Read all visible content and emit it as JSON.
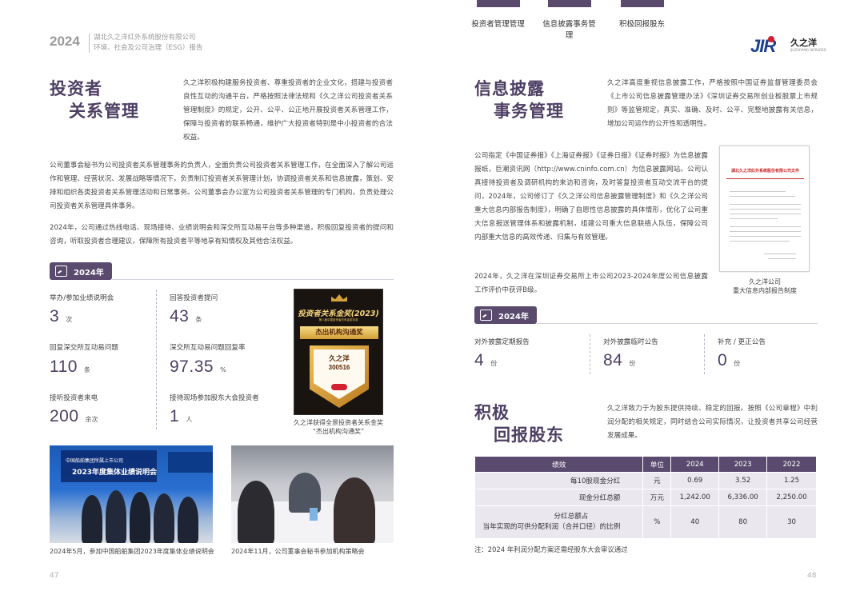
{
  "header": {
    "year": "2024",
    "company": "湖北久之洋红外系统股份有限公司",
    "report": "环境、社会及公司治理（ESG）报告"
  },
  "tabs": [
    {
      "label": "投资者管理管理"
    },
    {
      "label": "信息披露事务管理"
    },
    {
      "label": "积极回报股东"
    }
  ],
  "logo": {
    "mark": "JIR",
    "name": "久之洋",
    "tagline": "JIUZHIYANG INFRARED"
  },
  "left": {
    "title_line1": "投资者",
    "title_line2": "关系管理",
    "intro": "久之洋积极构建服务投资者、尊重投资者的企业文化，搭建与投资者良性互动的沟通平台，严格按照法律法规和《久之洋公司投资者关系管理制度》的规定，公开、公平、公正地开展投资者关系管理工作，保障与投资者的联系畅通，维护广大投资者特别是中小投资者的合法权益。",
    "para1": "公司董事会秘书为公司投资者关系管理事务的负责人，全面负责公司投资者关系管理工作，在全面深入了解公司运作和管理、经营状况、发展战略等情况下，负责制订投资者关系管理计划，协调投资者关系和信息披露，策划、安排和组织各类投资者关系管理活动和日常事务。公司董事会办公室为公司投资者关系管理的专门机构，负责处理公司投资者关系管理具体事务。",
    "para2": "2024年，公司通过热线电话、现场接待、业绩说明会和深交所互动易平台等多种渠道，积极回复投资者的提问和咨询，听取投资者合理建议，保障所有投资者平等地享有知情权及其他合法权益。",
    "badge": "2024年",
    "stats": [
      {
        "label": "举办/参加业绩说明会",
        "value": "3",
        "unit": "次"
      },
      {
        "label": "回答投资者提问",
        "value": "43",
        "unit": "条"
      },
      {
        "label": "回复深交所互动易问题",
        "value": "110",
        "unit": "条"
      },
      {
        "label": "深交所互动易问题回复率",
        "value": "97.35",
        "unit": "%"
      },
      {
        "label": "接听投资者来电",
        "value": "200",
        "unit": "余次"
      },
      {
        "label": "接待现场参加股东大会投资者",
        "value": "1",
        "unit": "人"
      }
    ],
    "award": {
      "title": "投资者关系金奖(2023)",
      "sub": "第八届中国投资者关系金奖评选",
      "ribbon": "杰出机构沟通奖",
      "name": "久之洋",
      "code": "300516",
      "caption1": "久之洋获得全景投资者关系金奖",
      "caption2": "“杰出机构沟通奖”"
    },
    "photo1": {
      "banner_small": "中国船舶集团所属上市公司",
      "banner_big": "2023年度集体业绩说明会",
      "caption": "2024年5月，参加中国船舶集团2023年度集体业绩说明会"
    },
    "photo2": {
      "caption": "2024年11月，公司董事会秘书参加机构策略会"
    },
    "page_no": "47"
  },
  "right": {
    "title_line1": "信息披露",
    "title_line2": "事务管理",
    "intro": "久之洋高度重视信息披露工作，严格按照中国证券监督管理委员会《上市公司信息披露管理办法》《深圳证券交易所创业板股票上市规则》等监管规定，真实、准确、及时、公平、完整地披露有关信息，增加公司运作的公开性和透明性。",
    "para1": "公司指定《中国证券报》《上海证券报》《证券日报》《证券时报》为信息披露报纸，巨潮资讯网（http://www.cninfo.com.cn）为信息披露网站。公司认真接待投资者及调研机构的来访和咨询，及时答复投资者互动交流平台的提问，2024年，公司修订了《久之洋公司信息披露管理制度》和《久之洋公司重大信息内部报告制度》，明确了自愿性信息披露的具体情形，优化了公司重大信息报送管理体系和披露机制，组建公司重大信息联络人队伍，保障公司内部重大信息的高效传递、归集与有效管理。",
    "para2": "2024年，久之洋在深圳证券交易所上市公司2023-2024年度公司信息披露工作评价中获评B级。",
    "doc": {
      "heading": "湖北久之洋红外系统股份有限公司文件",
      "caption1": "久之洋公司",
      "caption2": "重大信息内部报告制度"
    },
    "badge": "2024年",
    "stats": [
      {
        "label": "对外披露定期报告",
        "value": "4",
        "unit": "份"
      },
      {
        "label": "对外披露临时公告",
        "value": "84",
        "unit": "份"
      },
      {
        "label": "补充 / 更正公告",
        "value": "0",
        "unit": "份"
      }
    ],
    "return_title_line1": "积极",
    "return_title_line2": "回报股东",
    "return_intro": "久之洋致力于为股东提供持续、稳定的回报。按照《公司章程》中利润分配的相关规定，同时结合公司实际情况，让投资者共享公司经营发展成果。",
    "table": {
      "headers": [
        "绩效",
        "单位",
        "2024",
        "2023",
        "2022"
      ],
      "rows": [
        {
          "label": "每10股现金分红",
          "label2": "",
          "unit": "元",
          "v2024": "0.69",
          "v2023": "3.52",
          "v2022": "1.25"
        },
        {
          "label": "现金分红总额",
          "label2": "",
          "unit": "万元",
          "v2024": "1,242.00",
          "v2023": "6,336.00",
          "v2022": "2,250.00"
        },
        {
          "label": "分红总额占",
          "label2": "当年实现的可供分配利润（合并口径）的比例",
          "unit": "%",
          "v2024": "40",
          "v2023": "80",
          "v2022": "30"
        }
      ]
    },
    "note": "注：2024 年利润分配方案还需经股东大会审议通过",
    "page_no": "48"
  }
}
